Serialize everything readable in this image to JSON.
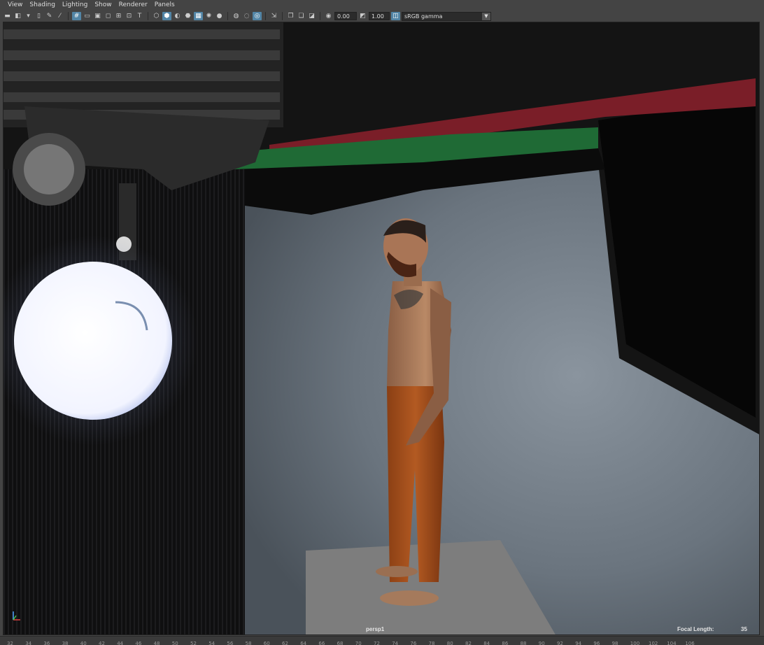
{
  "menu": [
    "View",
    "Shading",
    "Lighting",
    "Show",
    "Renderer",
    "Panels"
  ],
  "toolbar": {
    "exposure_value": "0.00",
    "gamma_value": "1.00",
    "color_space": "sRGB gamma"
  },
  "viewport": {
    "camera_name": "persp1",
    "focal_length_label": "Focal Length:",
    "focal_length_value": "35"
  },
  "timeline": {
    "ticks": [
      "32",
      "34",
      "36",
      "38",
      "40",
      "42",
      "44",
      "46",
      "48",
      "50",
      "52",
      "54",
      "56",
      "58",
      "60",
      "62",
      "64",
      "66",
      "68",
      "70",
      "72",
      "74",
      "76",
      "78",
      "80",
      "82",
      "84",
      "86",
      "88",
      "90",
      "92",
      "94",
      "96",
      "98",
      "100",
      "102",
      "104",
      "106"
    ]
  },
  "colors": {
    "accent": "#5285a6",
    "ui_bg": "#444444"
  }
}
